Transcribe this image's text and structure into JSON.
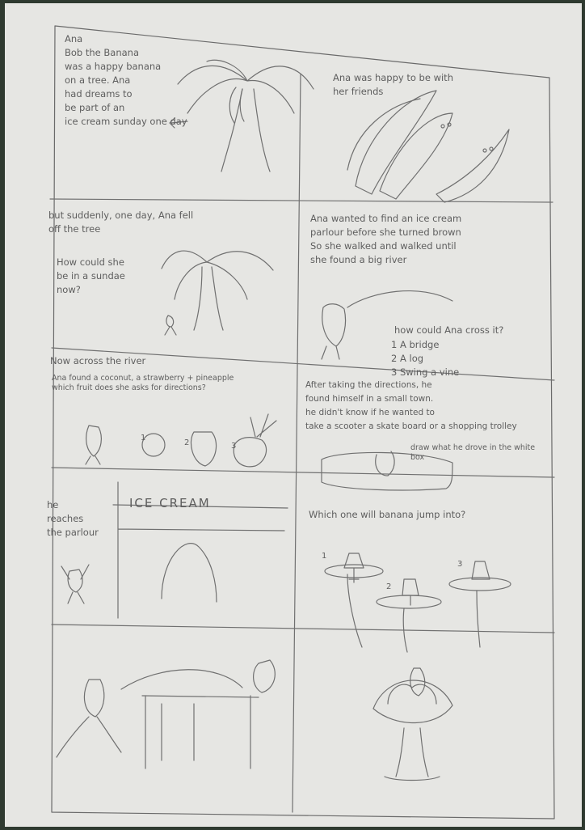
{
  "panels": {
    "p1": "Ana\nBob the Banana\nwas a happy banana\non a tree. Ana\nhad dreams to\nbe part of an\nice cream sunday one day",
    "p2": "Ana was happy to be with\nher friends",
    "p3_line1": "but suddenly, one day, Ana fell\noff the tree",
    "p3_line2": "How could she\nbe in a sundae\nnow?",
    "p4": "Ana wanted to find an ice cream\nparlour before she turned brown\nSo she walked and walked until\nshe found a big river",
    "p4_question": "how could Ana cross it?",
    "p4_options": "1 A bridge\n2 A log\n3 Swing a vine",
    "p5_title": "Now across the river",
    "p5_body": "Ana found a coconut, a strawberry + pineapple\nwhich fruit does she asks for directions?",
    "p6": "After taking the directions, he\nfound himself in a small town.\nhe didn't know if he wanted to\ntake a scooter a skate board or a shopping trolley",
    "p6_draw": "draw what he drove in the white\nbox",
    "p7_caption": "he\nreaches\nthe parlour",
    "p7_sign": "ICE CREAM",
    "p8": "Which one will banana jump into?",
    "numbers": [
      "1",
      "2",
      "3"
    ]
  }
}
